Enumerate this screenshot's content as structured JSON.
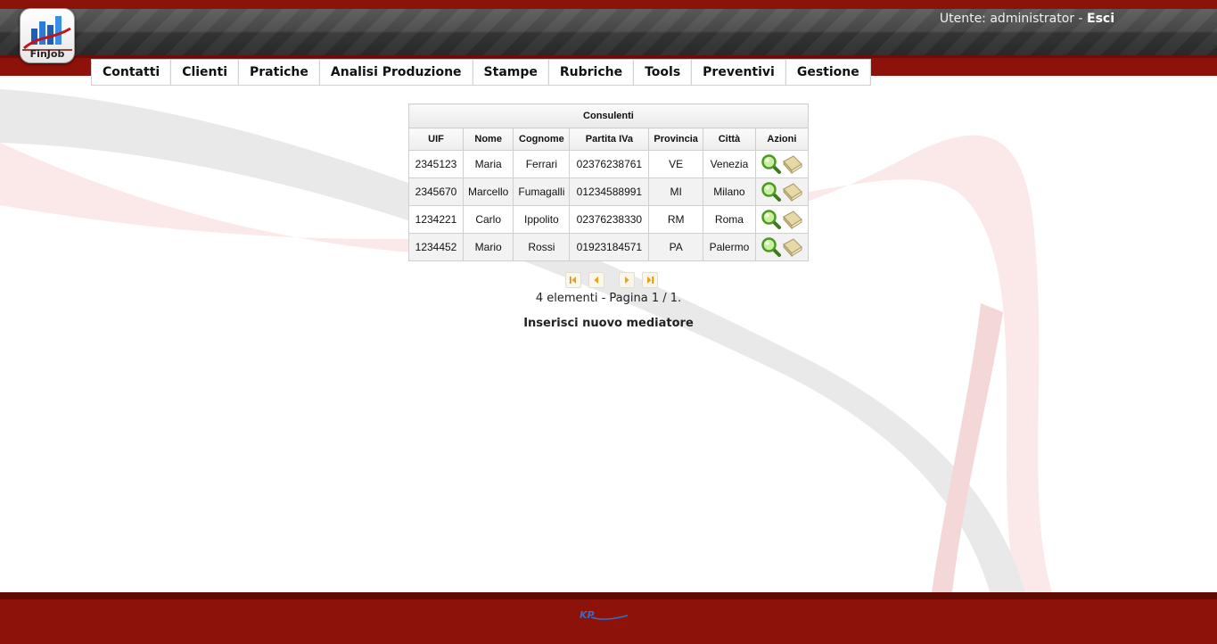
{
  "header": {
    "logo_text": "FinJob",
    "user_label": "Utente: administrator - ",
    "logout_label": "Esci"
  },
  "nav": {
    "items": [
      {
        "label": "Contatti"
      },
      {
        "label": "Clienti"
      },
      {
        "label": "Pratiche"
      },
      {
        "label": "Analisi Produzione"
      },
      {
        "label": "Stampe"
      },
      {
        "label": "Rubriche"
      },
      {
        "label": "Tools"
      },
      {
        "label": "Preventivi"
      },
      {
        "label": "Gestione"
      }
    ]
  },
  "table": {
    "caption": "Consulenti",
    "headers": [
      "UIF",
      "Nome",
      "Cognome",
      "Partita IVa",
      "Provincia",
      "Città",
      "Azioni"
    ],
    "rows": [
      {
        "uif": "2345123",
        "nome": "Maria",
        "cognome": "Ferrari",
        "piva": "02376238761",
        "provincia": "VE",
        "citta": "Venezia"
      },
      {
        "uif": "2345670",
        "nome": "Marcello",
        "cognome": "Fumagalli",
        "piva": "01234588991",
        "provincia": "MI",
        "citta": "Milano"
      },
      {
        "uif": "1234221",
        "nome": "Carlo",
        "cognome": "Ippolito",
        "piva": "02376238330",
        "provincia": "RM",
        "citta": "Roma"
      },
      {
        "uif": "1234452",
        "nome": "Mario",
        "cognome": "Rossi",
        "piva": "01923184571",
        "provincia": "PA",
        "citta": "Palermo"
      }
    ],
    "action_icons": [
      "magnifier-icon",
      "book-icon"
    ]
  },
  "pager": {
    "info": "4 elementi - Pagina 1 / 1.",
    "icons": [
      "first-page-icon",
      "prev-page-icon",
      "next-page-icon",
      "last-page-icon"
    ]
  },
  "new_link": "Inserisci nuovo mediatore",
  "footer": {
    "logo_text": "KP"
  },
  "colors": {
    "brand_red": "#8d1209",
    "header_gray": "#4a4a4a"
  }
}
